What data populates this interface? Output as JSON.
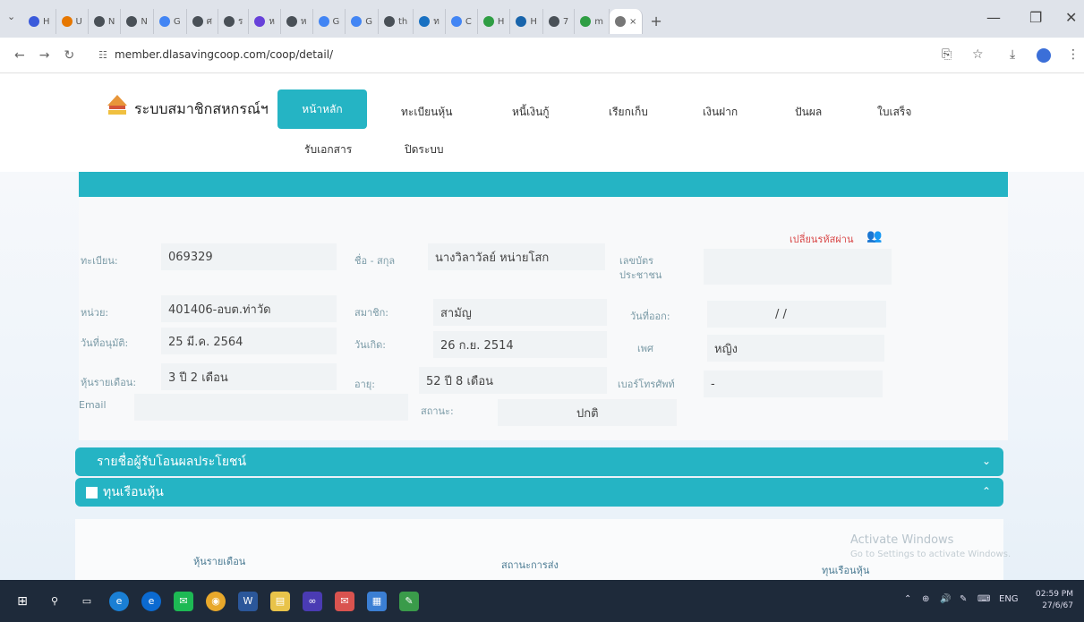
{
  "browser": {
    "tabs": [
      {
        "label": "H",
        "color": "#3b5bdb"
      },
      {
        "label": "U",
        "color": "#e67700"
      },
      {
        "label": "N",
        "color": "#495057"
      },
      {
        "label": "N",
        "color": "#495057"
      },
      {
        "label": "G",
        "color": "#4285f4"
      },
      {
        "label": "ศ",
        "color": "#495057"
      },
      {
        "label": "ร",
        "color": "#495057"
      },
      {
        "label": "ห",
        "color": "#6741d9"
      },
      {
        "label": "ห",
        "color": "#495057"
      },
      {
        "label": "G",
        "color": "#4285f4"
      },
      {
        "label": "G",
        "color": "#4285f4"
      },
      {
        "label": "th",
        "color": "#495057"
      },
      {
        "label": "ท",
        "color": "#1971c2"
      },
      {
        "label": "C",
        "color": "#4285f4"
      },
      {
        "label": "H",
        "color": "#2f9e44"
      },
      {
        "label": "H",
        "color": "#1864ab"
      },
      {
        "label": "7",
        "color": "#495057"
      },
      {
        "label": "m",
        "color": "#2f9e44"
      }
    ],
    "active_tab_close": "×",
    "new_tab": "+",
    "url": "member.dlasavingcoop.com/coop/detail/"
  },
  "site": {
    "title": "ระบบสมาชิกสหกรณ์ฯ",
    "menu": {
      "home": "หน้าหลัก",
      "shares": "ทะเบียนหุ้น",
      "loans": "หนี้เงินกู้",
      "billing": "เรียกเก็บ",
      "deposit": "เงินฝาก",
      "dividend": "ปันผล",
      "receipt": "ใบเสร็จ",
      "documents": "รับเอกสาร",
      "logout": "ปิดระบบ"
    }
  },
  "member": {
    "change_password": "เปลี่ยนรหัสผ่าน",
    "reg_label": "ทะเบียน:",
    "reg_value": "069329",
    "name_label": "ชื่อ - สกุล",
    "name_value": "นางวิลาวัลย์ หน่ายโสก",
    "id_label": "เลขบัตรประชาชน",
    "id_value": "",
    "unit_label": "หน่วย:",
    "unit_value": "401406-อบต.ท่าวัด",
    "member_type_label": "สมาชิก:",
    "member_type_value": "สามัญ",
    "leave_label": "วันที่ออก:",
    "leave_value": "/ /",
    "approve_label": "วันที่อนุมัติ:",
    "approve_value": "25 มี.ค. 2564",
    "birth_label": "วันเกิด:",
    "birth_value": "26 ก.ย. 2514",
    "gender_label": "เพศ",
    "gender_value": "หญิง",
    "monthly_share_label": "หุ้นรายเดือน:",
    "monthly_share_value": "3 ปี 2 เดือน",
    "age_label": "อายุ:",
    "age_value": "52 ปี 8 เดือน",
    "phone_label": "เบอร์โทรศัพท์",
    "phone_value": "-",
    "email_label": "Email",
    "email_value": "",
    "status_label": "สถานะ:",
    "status_value": "ปกติ"
  },
  "sections": {
    "beneficiaries": "รายชื่อผู้รับโอนผลประโยชน์",
    "share_capital": "ทุนเรือนหุ้น"
  },
  "share_table": {
    "col_monthly": "หุ้นรายเดือน",
    "col_status": "สถานะการส่ง",
    "col_capital": "ทุนเรือนหุ้น"
  },
  "watermark": {
    "line1": "Activate Windows",
    "line2": "Go to Settings to activate Windows."
  },
  "taskbar": {
    "lang": "ENG",
    "time": "02:59 PM",
    "date": "27/6/67"
  }
}
